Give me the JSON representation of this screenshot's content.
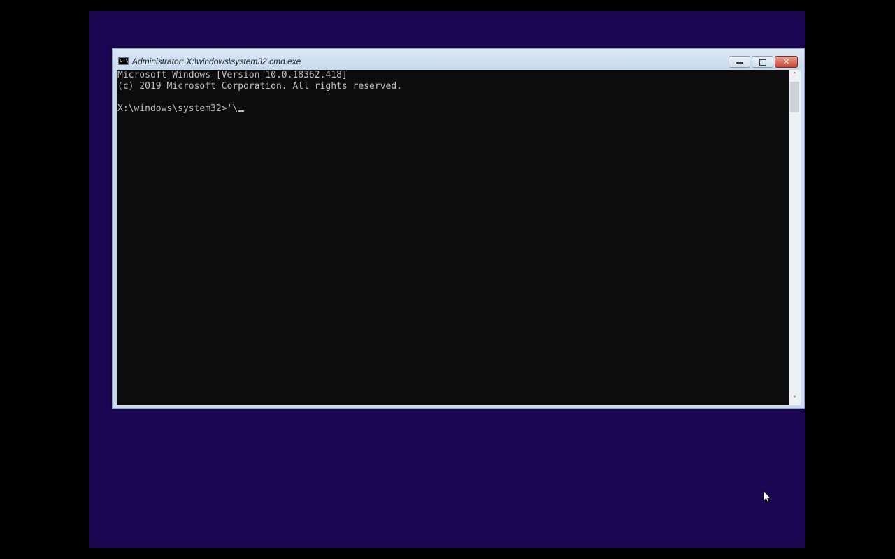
{
  "window": {
    "title": "Administrator: X:\\windows\\system32\\cmd.exe",
    "icon": "cmd-icon",
    "icon_glyph": "C:\\",
    "controls": {
      "minimize": "minimize-icon",
      "maximize": "maximize-icon",
      "close": "close-icon"
    }
  },
  "console": {
    "lines": [
      "Microsoft Windows [Version 10.0.18362.418]",
      "(c) 2019 Microsoft Corporation. All rights reserved.",
      "X:\\windows\\system32>'\\"
    ]
  },
  "scrollbar": {
    "up_arrow": "˄",
    "down_arrow": "˅"
  },
  "colors": {
    "desktop_background": "#1a0653",
    "console_background": "#0c0c0c",
    "console_text": "#c0c0c0"
  }
}
